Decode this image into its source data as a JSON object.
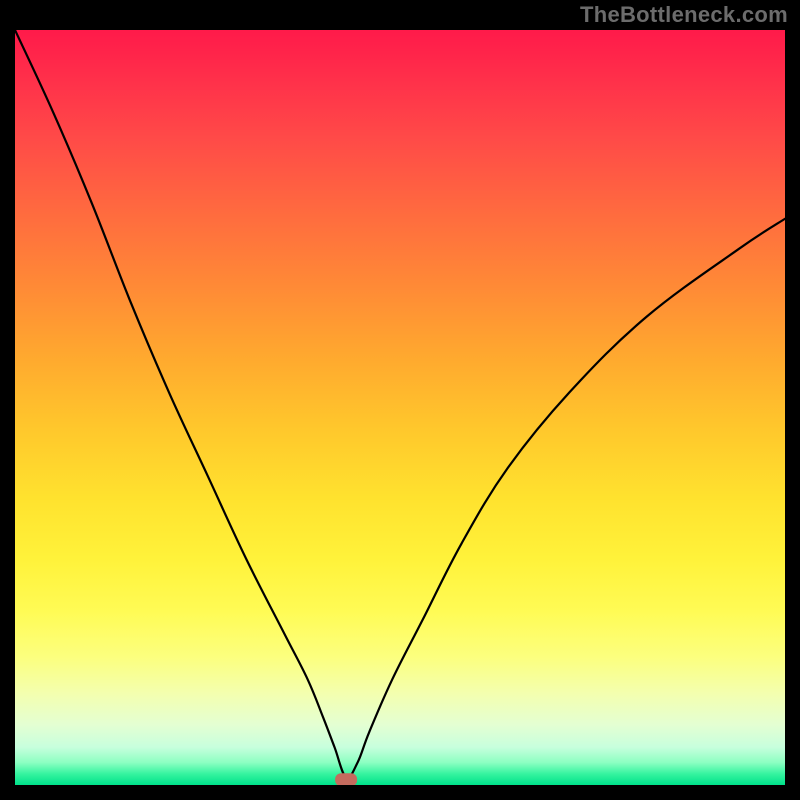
{
  "watermark": "TheBottleneck.com",
  "chart_data": {
    "type": "line",
    "title": "",
    "xlabel": "",
    "ylabel": "",
    "xlim": [
      0,
      100
    ],
    "ylim": [
      0,
      100
    ],
    "background_gradient": {
      "top": "#ff1a4a",
      "mid_upper": "#ff8a36",
      "mid": "#ffe22e",
      "mid_lower": "#fcff7e",
      "bottom": "#00e18a"
    },
    "curve": {
      "description": "V-shaped bottleneck curve with minimum near x=43, left branch steeper than right",
      "x": [
        0,
        5,
        10,
        15,
        20,
        25,
        30,
        35,
        38,
        40,
        41.5,
        43,
        44.5,
        46,
        49,
        53,
        58,
        64,
        72,
        82,
        94,
        100
      ],
      "y": [
        100,
        89,
        77,
        64,
        52,
        41,
        30,
        20,
        14,
        9,
        5,
        1,
        3,
        7,
        14,
        22,
        32,
        42,
        52,
        62,
        71,
        75
      ]
    },
    "marker": {
      "x": 43,
      "y": 0.7,
      "color": "#c46b5e",
      "shape": "rounded"
    }
  }
}
